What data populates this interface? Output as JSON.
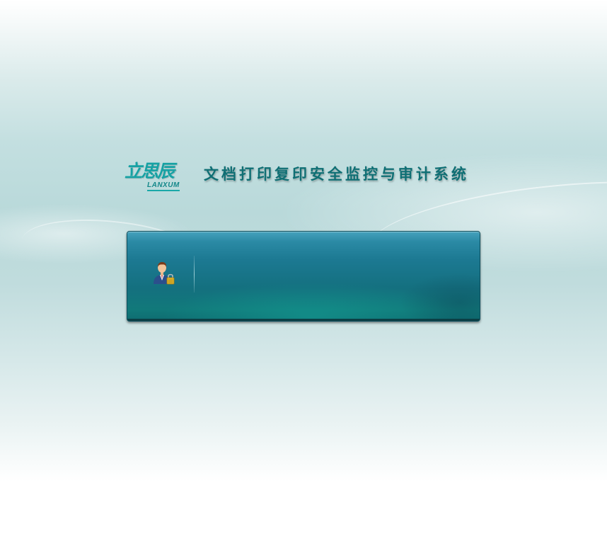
{
  "brand": {
    "logo_cn": "立思辰",
    "logo_en": "LANXUM"
  },
  "system_title": "文档打印复印安全监控与审计系统",
  "login_panel": {
    "icon": "user-lock-icon"
  }
}
